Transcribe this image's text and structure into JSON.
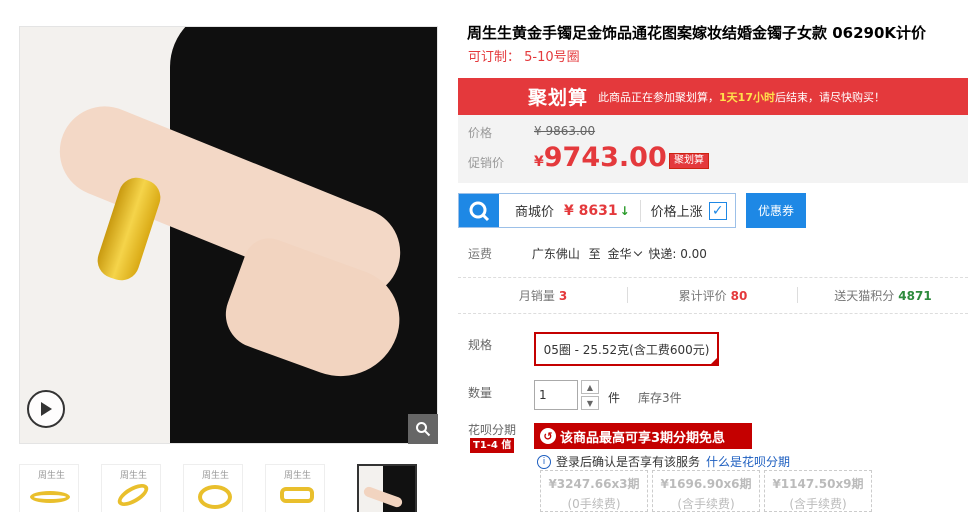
{
  "product": {
    "title": "周生生黄金手镯足金饰品通花图案嫁妆结婚金镯子女款 06290K计价",
    "subtitle": "可订制： 5-10号圈"
  },
  "gallery": {
    "thumbnails": [
      {
        "logo": "周生生"
      },
      {
        "logo": "周生生"
      },
      {
        "logo": "周生生"
      },
      {
        "logo": "周生生"
      },
      {
        "logo": ""
      }
    ]
  },
  "juhuasuan": {
    "logo": "聚划算",
    "text_pre": "此商品正在参加聚划算，",
    "time_left": "1天17小时",
    "text_post": "后结束，请尽快购买！"
  },
  "price": {
    "original_label": "价格",
    "original_value": "¥ 9863.00",
    "promo_label": "促销价",
    "promo_currency": "¥",
    "promo_value": "9743.00",
    "promo_tag": "聚划算"
  },
  "compare": {
    "mall_label": "商城价",
    "mall_price": "¥ 8631",
    "down_arrow": "↓",
    "price_rise_label": "价格上涨",
    "check": "✓",
    "coupon_label": "优惠券"
  },
  "shipping": {
    "label": "运费",
    "origin": "广东佛山",
    "to": "至",
    "destination": "金华",
    "express": "快递: 0.00"
  },
  "stats": [
    {
      "label": "月销量",
      "value": "3",
      "color": "#e4393c"
    },
    {
      "label": "累计评价",
      "value": "80",
      "color": "#e4393c"
    },
    {
      "label": "送天猫积分",
      "value": "4871",
      "color": "#2e8b3d"
    }
  ],
  "spec": {
    "label": "规格",
    "selected": "05圈 - 25.52克(含工费600元)"
  },
  "quantity": {
    "label": "数量",
    "value": "1",
    "unit": "件",
    "stock": "库存3件"
  },
  "huabei": {
    "label": "花呗分期",
    "tag": "T1-4 信",
    "banner": "该商品最高可享3期分期免息",
    "notice": "登录后确认是否享有该服务",
    "link": "什么是花呗分期",
    "plans": [
      {
        "amount": "¥3247.66x3期",
        "fee": "(0手续费)"
      },
      {
        "amount": "¥1696.90x6期",
        "fee": "(含手续费)"
      },
      {
        "amount": "¥1147.50x9期",
        "fee": "(含手续费)"
      }
    ]
  },
  "colors": {
    "accent_red": "#e4393c",
    "tmall_red": "#c40000",
    "blue": "#1e88e5",
    "green": "#2e8b3d"
  }
}
